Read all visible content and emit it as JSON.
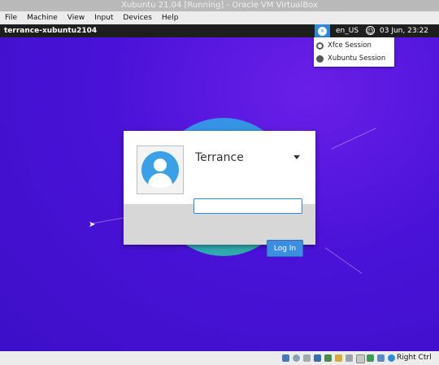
{
  "window": {
    "title": "Xubuntu 21.04 [Running] - Oracle VM VirtualBox"
  },
  "menu": [
    "File",
    "Machine",
    "View",
    "Input",
    "Devices",
    "Help"
  ],
  "topbar": {
    "hostname": "terrance-xubuntu2104",
    "session_icon": "xfce-session-icon",
    "locale": "en_US",
    "accessibility_icon": "accessibility-icon",
    "clock": "03 Jun, 23:22"
  },
  "session_menu": [
    {
      "label": "Xfce Session",
      "selected": true
    },
    {
      "label": "Xubuntu Session",
      "selected": false
    }
  ],
  "login": {
    "username": "Terrance",
    "password_value": "",
    "button": "Log In"
  },
  "statusbar": {
    "host_key": "Right Ctrl",
    "icons": [
      "hdd-icon",
      "optical-drive-icon",
      "audio-icon",
      "network-icon",
      "usb-icon",
      "shared-folder-icon",
      "display-icon",
      "recording-icon",
      "cpu-icon",
      "mouse-integration-icon",
      "keyboard-icon"
    ]
  },
  "colors": {
    "accent": "#2d8ad8",
    "desktop": "#4a12d8",
    "topbar": "#1e1e1e"
  }
}
